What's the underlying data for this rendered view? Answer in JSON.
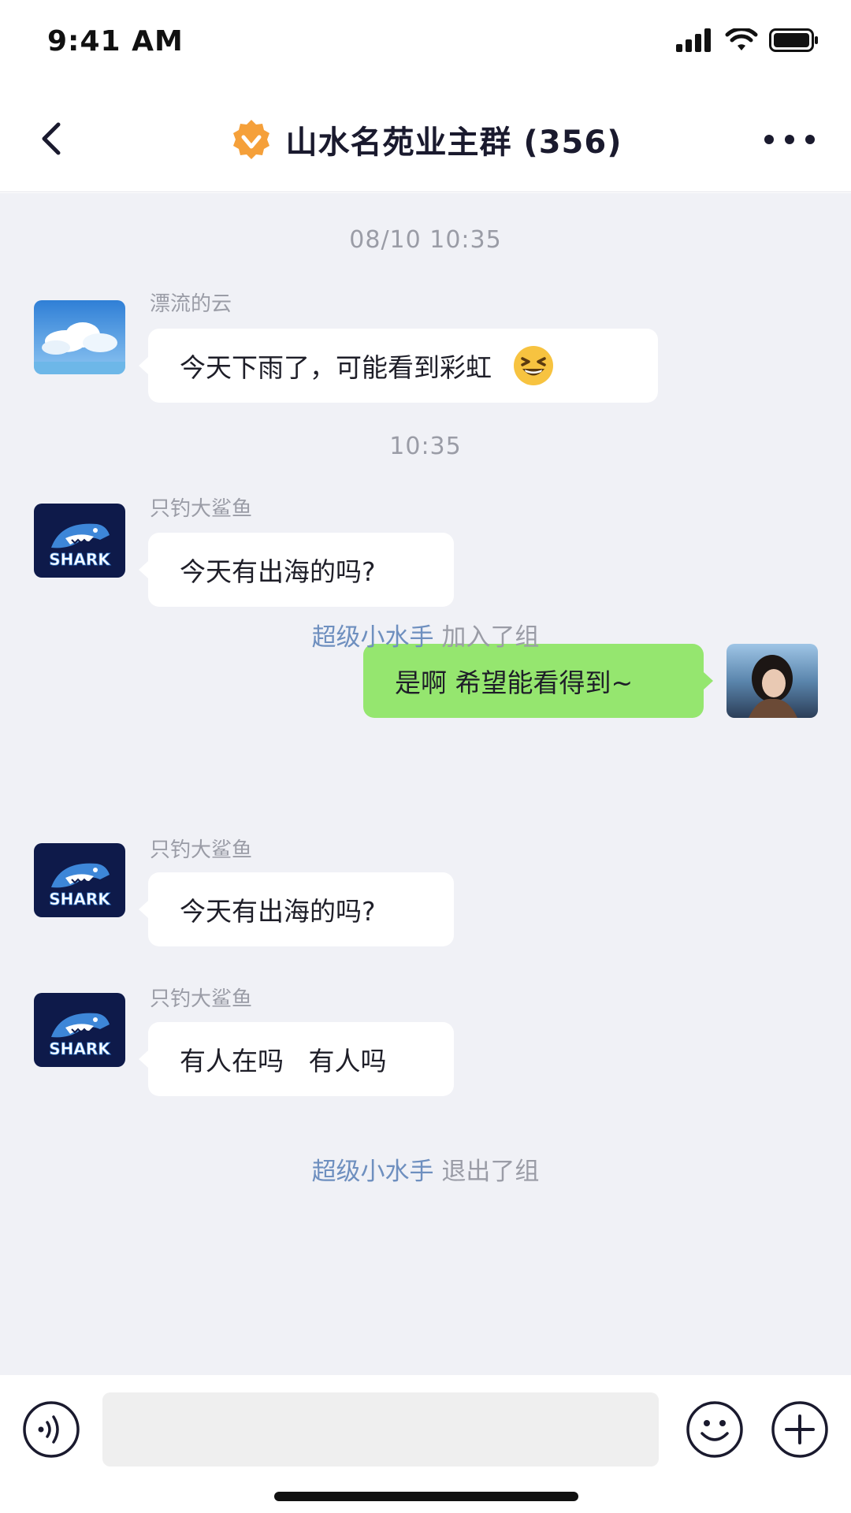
{
  "status_bar": {
    "time": "9:41 AM",
    "icons": [
      "cellular-signal-icon",
      "wifi-icon",
      "battery-icon"
    ]
  },
  "nav": {
    "title": "山水名苑业主群 (356)",
    "back_icon": "chevron-left-icon",
    "badge_icon": "verified-badge-icon",
    "more_icon": "more-dots-icon",
    "badge_color": "#f5a03a"
  },
  "chat": {
    "timestamps": [
      "08/10 10:35",
      "10:35"
    ],
    "messages": [
      {
        "sender": "漂流的云",
        "text": "今天下雨了，可能看到彩虹",
        "emoji": "😆",
        "avatar": "cloud-sky-avatar"
      },
      {
        "sender": "只钓大鲨鱼",
        "text": "今天有出海的吗?",
        "avatar": "shark-logo-avatar",
        "avatar_label": "SHARK"
      },
      {
        "sender": "",
        "text": "是啊 希望能看得到~",
        "avatar": "user-photo-avatar",
        "self": true
      },
      {
        "sender": "只钓大鲨鱼",
        "text": "今天有出海的吗?",
        "avatar": "shark-logo-avatar",
        "avatar_label": "SHARK"
      },
      {
        "sender": "只钓大鲨鱼",
        "text": "有人在吗   有人吗",
        "avatar": "shark-logo-avatar",
        "avatar_label": "SHARK"
      }
    ],
    "system_events": [
      {
        "user": "超级小水手",
        "action": "加入了组"
      },
      {
        "user": "超级小水手",
        "action": "退出了组"
      }
    ]
  },
  "input_bar": {
    "placeholder": "",
    "icons": [
      "voice-icon",
      "emoji-icon",
      "plus-icon"
    ]
  },
  "colors": {
    "self_bubble": "#95e66f",
    "other_bubble": "#ffffff",
    "chat_background": "#f0f1f6",
    "system_user": "#6e8fbf"
  }
}
